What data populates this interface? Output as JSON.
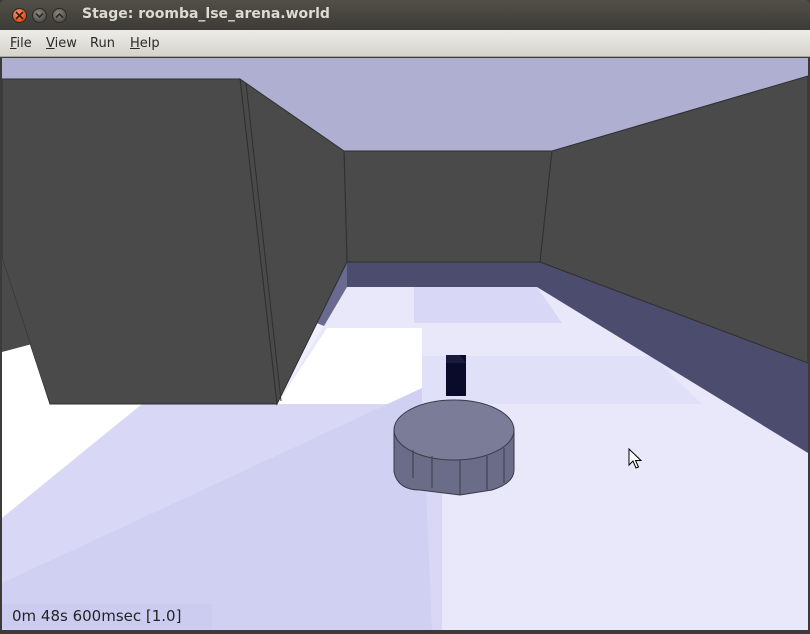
{
  "window": {
    "title": "Stage: roomba_lse_arena.world"
  },
  "window_controls": {
    "close_icon": "close-icon",
    "minimize_icon": "minimize-icon",
    "maximize_icon": "maximize-icon"
  },
  "menu": {
    "items": [
      {
        "mnemonic": "F",
        "rest": "ile"
      },
      {
        "mnemonic": "V",
        "rest": "iew"
      },
      {
        "mnemonic": "",
        "rest": "Run"
      },
      {
        "mnemonic": "H",
        "rest": "elp"
      }
    ]
  },
  "status": {
    "clock": "0m 48s 600msec [1.0]"
  },
  "scene": {
    "wall_color": "#4a4a4a",
    "ceiling_color": "#afafd2",
    "floor_color": "#eeeefc",
    "robot_color": "#767896",
    "blob_color": "#0a0a2a"
  }
}
